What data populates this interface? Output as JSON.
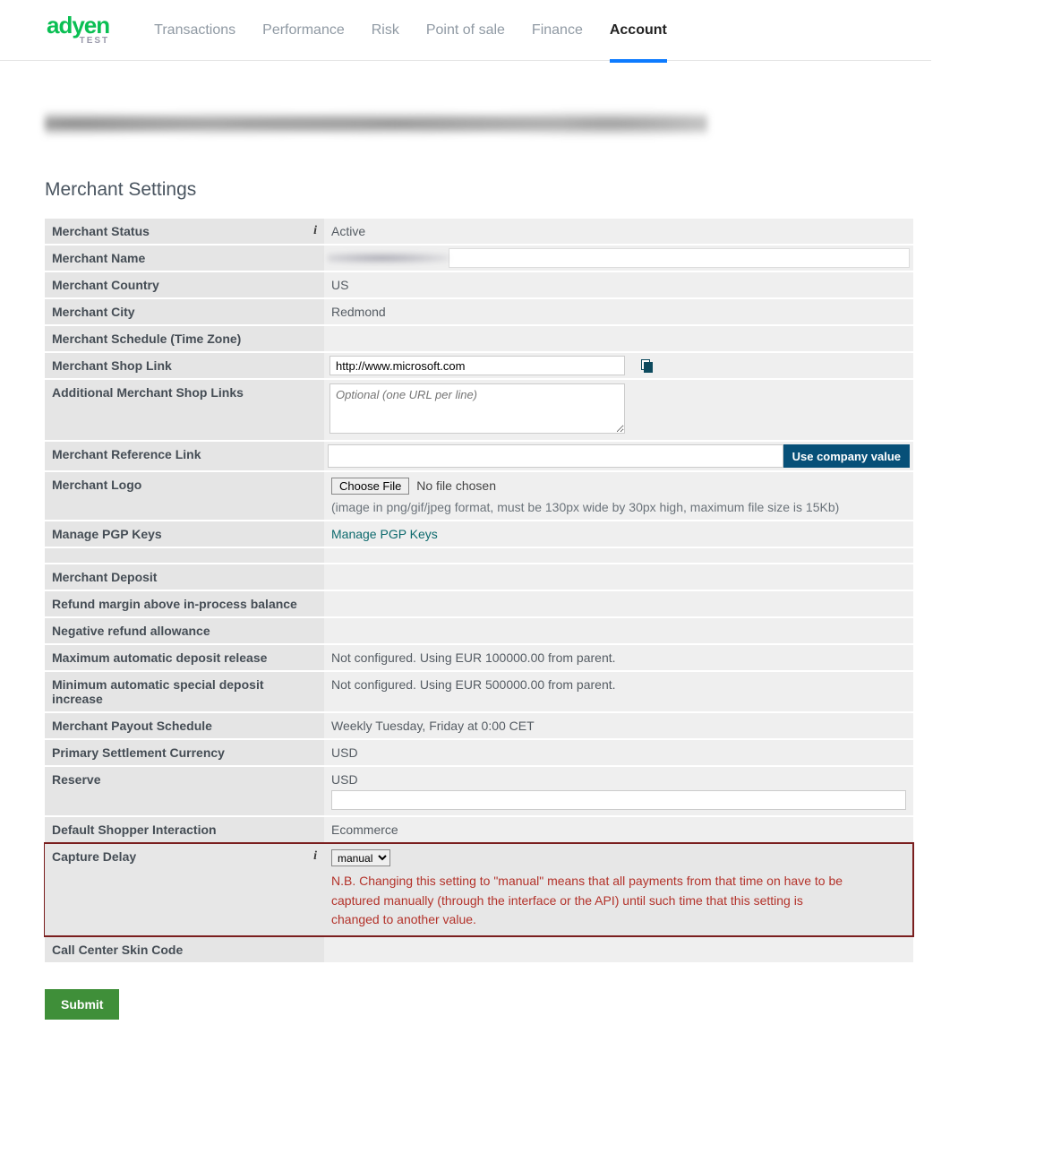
{
  "brand": {
    "name": "adyen",
    "sub": "TEST"
  },
  "nav": {
    "items": [
      {
        "label": "Transactions",
        "active": false
      },
      {
        "label": "Performance",
        "active": false
      },
      {
        "label": "Risk",
        "active": false
      },
      {
        "label": "Point of sale",
        "active": false
      },
      {
        "label": "Finance",
        "active": false
      },
      {
        "label": "Account",
        "active": true
      }
    ]
  },
  "section_title": "Merchant Settings",
  "labels": {
    "merchant_status": "Merchant Status",
    "merchant_name": "Merchant Name",
    "merchant_country": "Merchant Country",
    "merchant_city": "Merchant City",
    "merchant_schedule": "Merchant Schedule (Time Zone)",
    "shop_link": "Merchant Shop Link",
    "add_shop_links": "Additional Merchant Shop Links",
    "ref_link": "Merchant Reference Link",
    "logo": "Merchant Logo",
    "pgp": "Manage PGP Keys",
    "deposit": "Merchant Deposit",
    "refund_margin": "Refund margin above in-process balance",
    "neg_refund": "Negative refund allowance",
    "max_auto_deposit": "Maximum automatic deposit release",
    "min_auto_special": "Minimum automatic special deposit increase",
    "payout_schedule": "Merchant Payout Schedule",
    "primary_settlement": "Primary Settlement Currency",
    "reserve": "Reserve",
    "default_shopper": "Default Shopper Interaction",
    "capture_delay": "Capture Delay",
    "call_center": "Call Center Skin Code"
  },
  "values": {
    "merchant_status": "Active",
    "merchant_country": "US",
    "merchant_city": "Redmond",
    "merchant_schedule": "",
    "shop_link": "http://www.microsoft.com",
    "add_shop_links_placeholder": "Optional (one URL per line)",
    "ref_link_button": "Use company value",
    "choose_file": "Choose File",
    "no_file": "No file chosen",
    "logo_hint": "(image in png/gif/jpeg format, must be 130px wide by 30px high, maximum file size is 15Kb)",
    "pgp_link": "Manage PGP Keys",
    "deposit": "",
    "refund_margin": "",
    "neg_refund": "",
    "max_auto_deposit": "Not configured. Using EUR 100000.00 from parent.",
    "min_auto_special": "Not configured. Using EUR 500000.00 from parent.",
    "payout_schedule": "Weekly Tuesday, Friday at 0:00 CET",
    "primary_settlement": "USD",
    "reserve": "USD",
    "default_shopper": "Ecommerce",
    "capture_delay_selected": "manual",
    "capture_warning": "N.B. Changing this setting to \"manual\" means that all payments from that time on have to be captured manually (through the interface or the API) until such time that this setting is changed to another value.",
    "call_center": ""
  },
  "buttons": {
    "submit": "Submit"
  },
  "icons": {
    "info": "i"
  },
  "colors": {
    "accent_green": "#0abf53",
    "accent_blue": "#0d7bff",
    "warn_red": "#b3322a",
    "dark_teal": "#075078"
  }
}
